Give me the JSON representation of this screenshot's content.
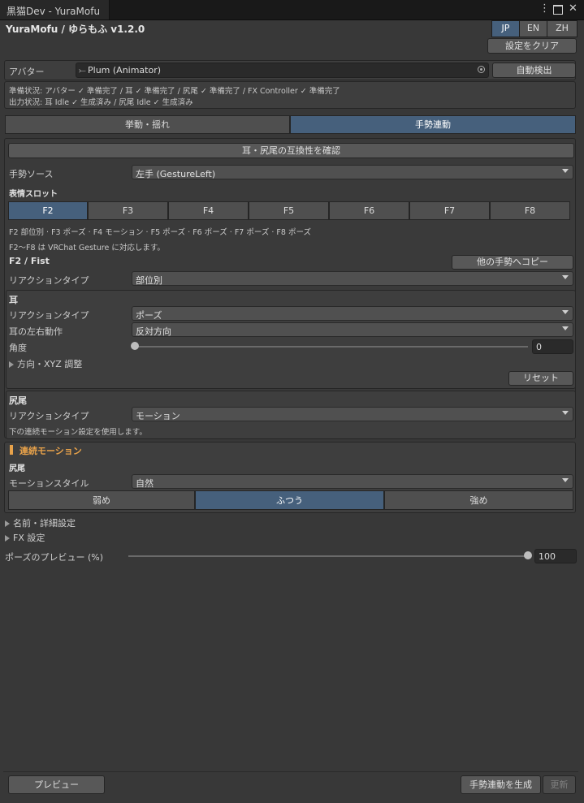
{
  "window": {
    "tab_title": "黒猫Dev - YuraMofu",
    "app_title": "YuraMofu / ゆらもふ v1.2.0",
    "menu_icon": "kebab-menu-icon",
    "maximize_icon": "maximize-icon",
    "close_icon": "close-icon"
  },
  "languages": [
    {
      "label": "JP",
      "active": true
    },
    {
      "label": "EN",
      "active": false
    },
    {
      "label": "ZH",
      "active": false
    }
  ],
  "clear_settings_label": "設定をクリア",
  "avatar": {
    "label": "アバター",
    "value": "Plum (Animator)",
    "auto_detect_label": "自動検出"
  },
  "status": {
    "line1": "準備状況: アバター ✓ 準備完了 / 耳 ✓ 準備完了 / 尻尾 ✓ 準備完了 / FX Controller ✓ 準備完了",
    "line2": "出力状況: 耳 Idle ✓ 生成済み / 尻尾 Idle ✓ 生成済み"
  },
  "main_tabs": [
    {
      "label": "挙動・揺れ",
      "active": false
    },
    {
      "label": "手勢連動",
      "active": true
    }
  ],
  "compat_button_label": "耳・尻尾の互換性を確認",
  "gesture_source": {
    "label": "手勢ソース",
    "value": "左手 (GestureLeft)"
  },
  "expression_slots": {
    "title": "表情スロット",
    "slots": [
      "F2",
      "F3",
      "F4",
      "F5",
      "F6",
      "F7",
      "F8"
    ],
    "active_index": 0,
    "summary": "F2 部位別 · F3 ポーズ · F4 モーション · F5 ポーズ · F6 ポーズ · F7 ポーズ · F8 ポーズ",
    "note": "F2〜F8 は VRChat Gesture に対応します。"
  },
  "slot_detail": {
    "title": "F2 / Fist",
    "copy_button_label": "他の手勢へコピー",
    "reaction_type_label": "リアクションタイプ",
    "reaction_type_value": "部位別"
  },
  "ears": {
    "title": "耳",
    "reaction_type_label": "リアクションタイプ",
    "reaction_type_value": "ポーズ",
    "lr_motion_label": "耳の左右動作",
    "lr_motion_value": "反対方向",
    "angle_label": "角度",
    "angle_value": "0",
    "angle_fraction": 0,
    "xyz_foldout_label": "方向・XYZ 調整",
    "reset_label": "リセット"
  },
  "tail": {
    "title": "尻尾",
    "reaction_type_label": "リアクションタイプ",
    "reaction_type_value": "モーション",
    "note": "下の連続モーション設定を使用します。"
  },
  "continuous_motion": {
    "title": "連続モーション",
    "accent_color": "#e8a24a",
    "sub_title": "尻尾",
    "style_label": "モーションスタイル",
    "style_value": "自然",
    "strengths": [
      {
        "label": "弱め",
        "active": false
      },
      {
        "label": "ふつう",
        "active": true
      },
      {
        "label": "強め",
        "active": false
      }
    ]
  },
  "foldouts": {
    "name_detail_label": "名前・詳細設定",
    "fx_label": "FX 設定"
  },
  "pose_preview": {
    "label": "ポーズのプレビュー (%)",
    "value": "100",
    "fraction": 1
  },
  "footer": {
    "preview_label": "プレビュー",
    "generate_label": "手勢連動を生成",
    "update_label": "更新"
  },
  "colors": {
    "active_blue": "#46607c",
    "background": "#383838"
  }
}
